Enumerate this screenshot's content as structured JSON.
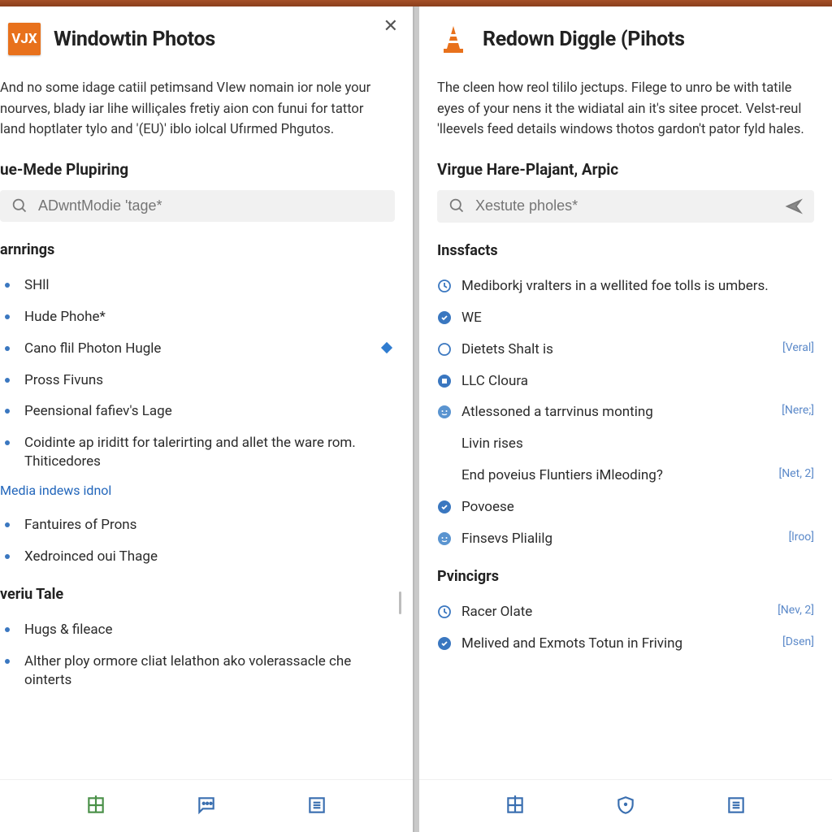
{
  "left": {
    "logo_text": "VJX",
    "title": "Windowtin Photos",
    "description": "And no some idage catiil petimsand VIew nomain ior nole your nourves, blady iar lihe williçales fretiy aion con funui for tattor land hoptlater tylo and '(EU)' iblo iolcal Ufırmed Phgutos.",
    "subhead": "ue-Mede Plupiring",
    "search_placeholder": "ADwntModie 'tage*",
    "section1_title": "arnrings",
    "section1_items": [
      {
        "label": "SHll",
        "icon": "dot"
      },
      {
        "label": "Hude Phohe*",
        "icon": "dot"
      },
      {
        "label": "Cano flil Photon Hugle",
        "icon": "dot",
        "diamond": true
      },
      {
        "label": "Pross Fivuns",
        "icon": "dot"
      },
      {
        "label": "Peensional fafiev's Lage",
        "icon": "dot"
      },
      {
        "label": "Coidinte ap iriditt for talerirting and allet the ware rom. Thiticedores",
        "icon": "dot"
      }
    ],
    "link_text": "Media indews idnol",
    "section1b_items": [
      {
        "label": "Fantuires of Prons",
        "icon": "dot"
      },
      {
        "label": "Xedroinced oui Thage",
        "icon": "dot"
      }
    ],
    "section2_title": "veriu Tale",
    "section2_items": [
      {
        "label": "Hugs & fileace",
        "icon": "dot"
      },
      {
        "label": "Alther ploy ormore cliat lelathon ako volerassacle che ointerts",
        "icon": "dot"
      }
    ]
  },
  "right": {
    "title": "Redown Diggle (Pihots",
    "description": "The cleen how reol tililo jectups. Filege to unro be with tatile eyes of your nens it the widiatal ain it's sitee procet. Velst-reul 'lleevels feed details windows thotos gardon't pator fyld hales.",
    "subhead": "Virgue Hare-Plajant, Arpic",
    "search_placeholder": "Xestute pholes*",
    "section1_title": "Inssfacts",
    "section1_items": [
      {
        "label": "Mediborkj vralters in a wellited foe tolls is umbers.",
        "icon": "clock"
      },
      {
        "label": "WE",
        "icon": "solid"
      },
      {
        "label": "Dietets Shalt is",
        "icon": "circle",
        "badge": "[Veral]"
      },
      {
        "label": "LLC Cloura",
        "icon": "solid2"
      },
      {
        "label": "Atlessoned a tarrvinus monting",
        "icon": "face",
        "badge": "[Nere;]"
      },
      {
        "label": "Livin rises",
        "icon": "none"
      },
      {
        "label": "End poveius Fluntiers iMleoding?",
        "icon": "none",
        "badge": "[Net, 2]"
      },
      {
        "label": "Povoese",
        "icon": "solid"
      },
      {
        "label": "Finsevs Plialilg",
        "icon": "face",
        "badge": "[lroo]"
      }
    ],
    "section2_title": "Pvincigrs",
    "section2_items": [
      {
        "label": "Racer Olate",
        "icon": "clock",
        "badge": "[Nev, 2]"
      },
      {
        "label": "Melived and Exmots Totun in Friving",
        "icon": "solid",
        "badge": "[Dsen]"
      }
    ]
  }
}
